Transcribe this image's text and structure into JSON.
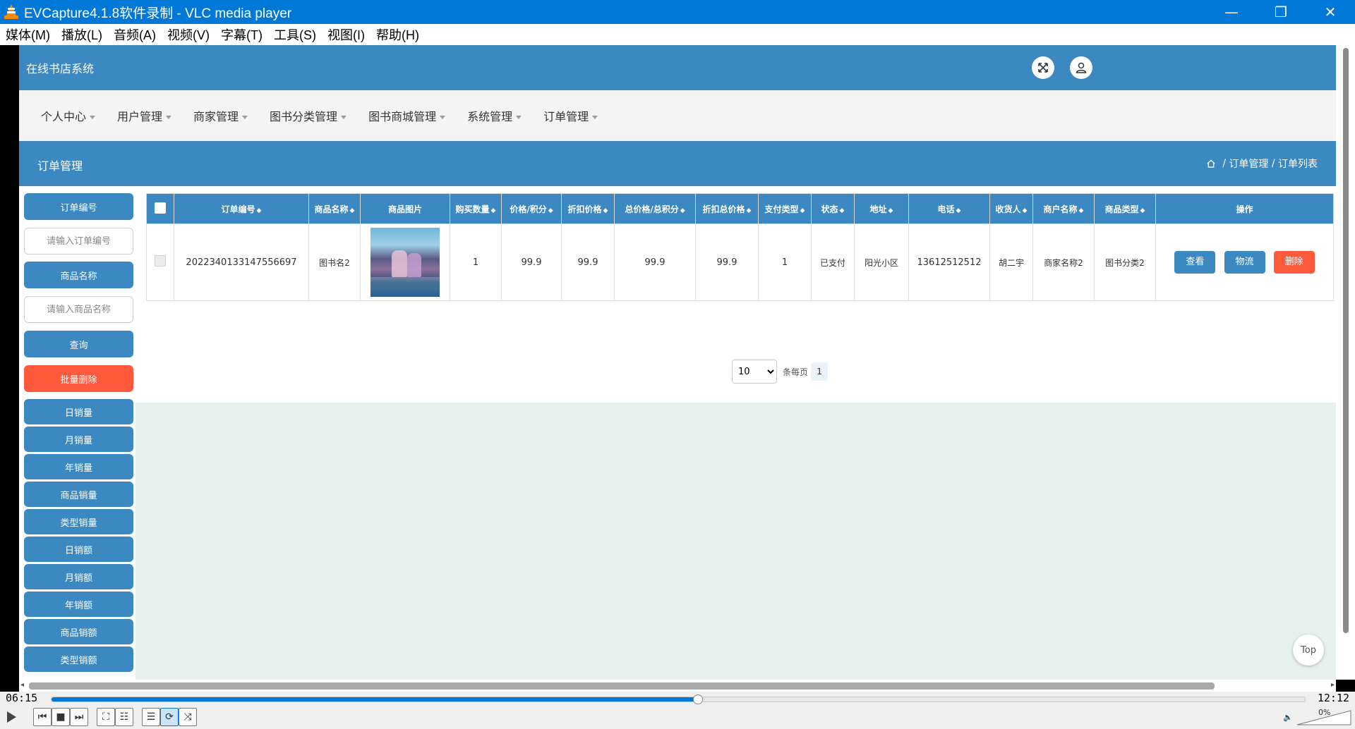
{
  "window": {
    "title": "EVCapture4.1.8软件录制 - VLC media player",
    "controls": [
      "—",
      "❐",
      "✕"
    ]
  },
  "menubar": [
    "媒体(M)",
    "播放(L)",
    "音频(A)",
    "视频(V)",
    "字幕(T)",
    "工具(S)",
    "视图(I)",
    "帮助(H)"
  ],
  "site": {
    "logo": "在线书店系统",
    "nav": [
      "个人中心",
      "用户管理",
      "商家管理",
      "图书分类管理",
      "图书商城管理",
      "系统管理",
      "订单管理"
    ],
    "page_title": "订单管理",
    "breadcrumb": [
      "订单管理",
      "订单列表"
    ]
  },
  "filters": {
    "order_no_label": "订单编号",
    "order_no_placeholder": "请输入订单编号",
    "goods_name_label": "商品名称",
    "goods_name_placeholder": "请输入商品名称",
    "query": "查询",
    "batch_delete": "批量删除",
    "stats": [
      "日销量",
      "月销量",
      "年销量",
      "商品销量",
      "类型销量",
      "日销额",
      "月销额",
      "年销额",
      "商品销额",
      "类型销额"
    ]
  },
  "table": {
    "columns": [
      "订单编号",
      "商品名称",
      "商品图片",
      "购买数量",
      "价格/积分",
      "折扣价格",
      "总价格/总积分",
      "折扣总价格",
      "支付类型",
      "状态",
      "地址",
      "电话",
      "收货人",
      "商户名称",
      "商品类型",
      "操作"
    ],
    "row": {
      "order_no": "2022340133147556697",
      "goods_name": "图书名2",
      "qty": "1",
      "price": "99.9",
      "discount_price": "99.9",
      "total": "99.9",
      "discount_total": "99.9",
      "pay_type": "1",
      "status": "已支付",
      "address": "阳光小区",
      "phone": "13612512512",
      "receiver": "胡二宇",
      "merchant": "商家名称2",
      "goods_type": "图书分类2"
    },
    "actions": [
      "查看",
      "物流",
      "删除"
    ]
  },
  "pager": {
    "page_size": "10",
    "per_page_label": "条每页",
    "current": "1"
  },
  "top_button": "Top",
  "player": {
    "elapsed": "06:15",
    "total": "12:12",
    "progress": 0.515,
    "volume": "0%"
  }
}
